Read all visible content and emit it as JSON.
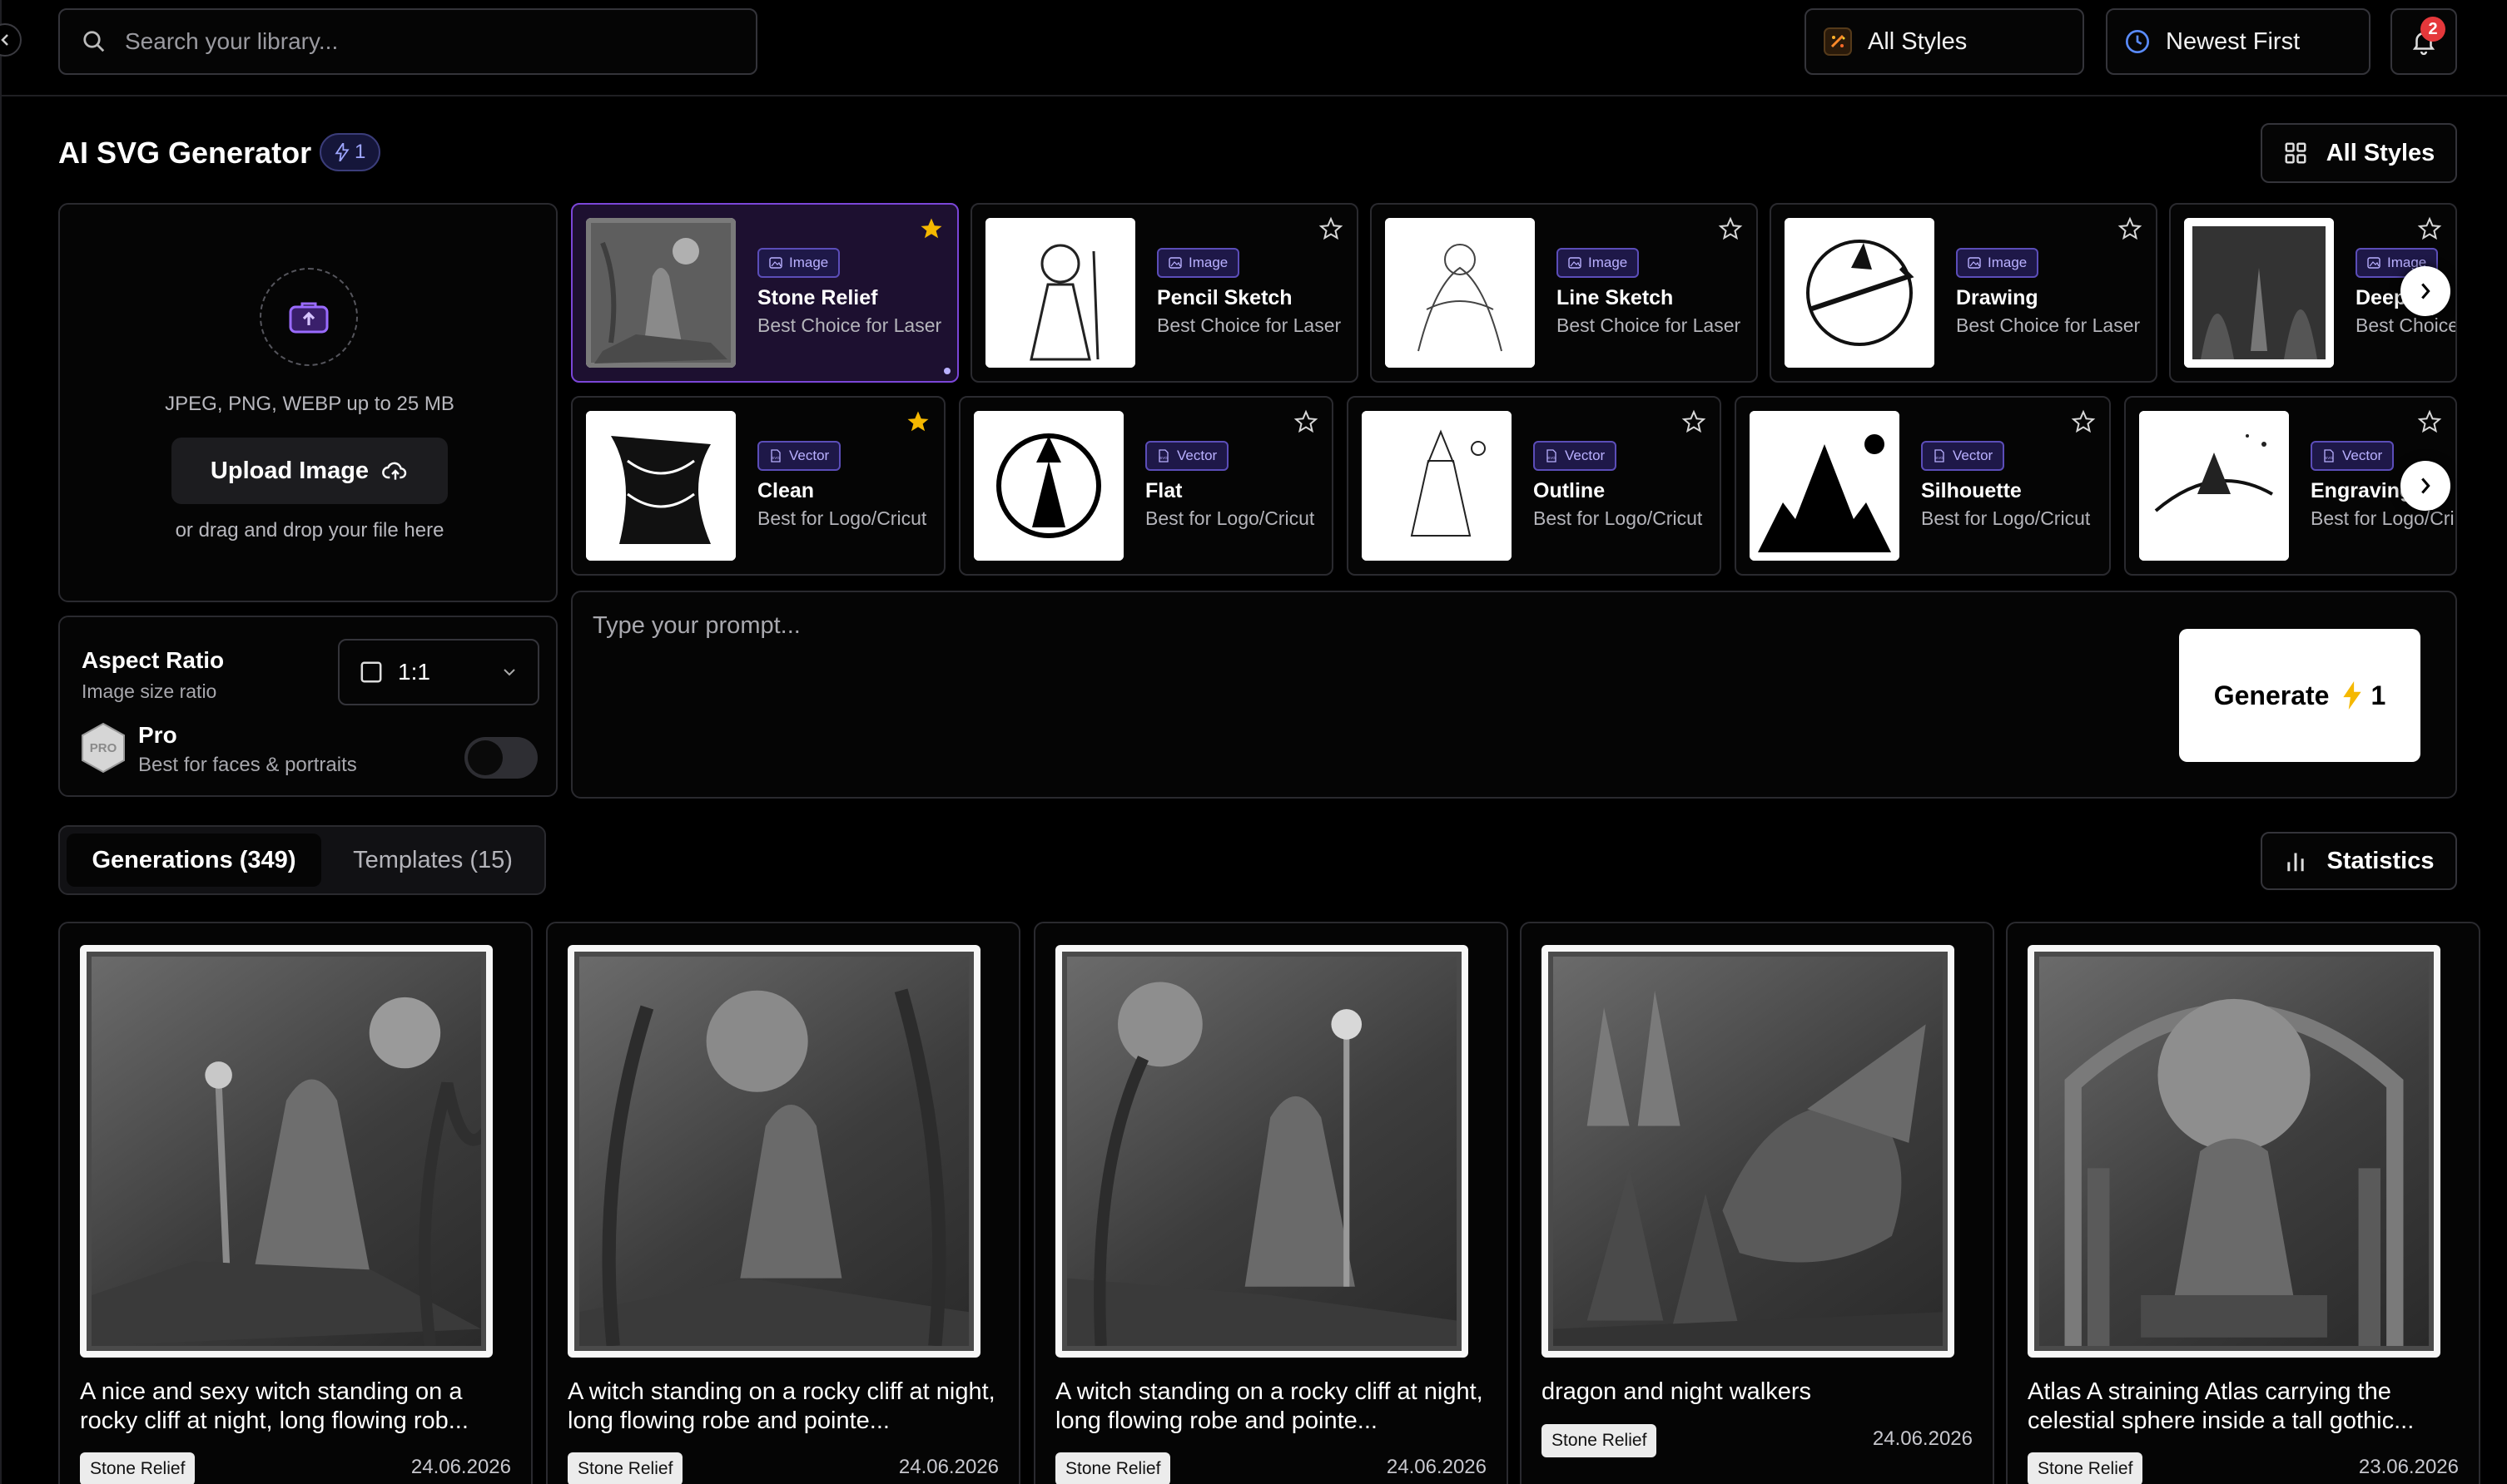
{
  "topbar": {
    "search_placeholder": "Search your library...",
    "style_filter": "All Styles",
    "sort": "Newest First",
    "notifications_count": "2"
  },
  "header": {
    "title": "AI SVG Generator",
    "credits": "1",
    "all_styles_button": "All Styles"
  },
  "upload": {
    "formats": "JPEG, PNG, WEBP up to 25 MB",
    "button": "Upload Image",
    "drag_hint": "or drag and drop your file here"
  },
  "aspect": {
    "title": "Aspect Ratio",
    "subtitle": "Image size ratio",
    "value": "1:1",
    "pro_badge": "PRO",
    "pro_label": "Pro",
    "pro_sub": "Best for faces & portraits"
  },
  "styles_row1": [
    {
      "tag": "Image",
      "name": "Stone Relief",
      "sub": "Best Choice for Laser",
      "favorite": true,
      "selected": true
    },
    {
      "tag": "Image",
      "name": "Pencil Sketch",
      "sub": "Best Choice for Laser",
      "favorite": false
    },
    {
      "tag": "Image",
      "name": "Line Sketch",
      "sub": "Best Choice for Laser",
      "favorite": false
    },
    {
      "tag": "Image",
      "name": "Drawing",
      "sub": "Best Choice for Laser",
      "favorite": false
    },
    {
      "tag": "Image",
      "name": "Deep Ra",
      "sub": "Best Choice",
      "favorite": false
    }
  ],
  "styles_row2": [
    {
      "tag": "Vector",
      "name": "Clean",
      "sub": "Best for Logo/Cricut",
      "favorite": true
    },
    {
      "tag": "Vector",
      "name": "Flat",
      "sub": "Best for Logo/Cricut",
      "favorite": false
    },
    {
      "tag": "Vector",
      "name": "Outline",
      "sub": "Best for Logo/Cricut",
      "favorite": false
    },
    {
      "tag": "Vector",
      "name": "Silhouette",
      "sub": "Best for Logo/Cricut",
      "favorite": false
    },
    {
      "tag": "Vector",
      "name": "Engraving",
      "sub": "Best for Logo/Cri",
      "favorite": false
    }
  ],
  "prompt": {
    "placeholder": "Type your prompt...",
    "generate_label": "Generate",
    "generate_cost": "1"
  },
  "tabs": {
    "generations": "Generations (349)",
    "templates": "Templates (15)",
    "statistics": "Statistics"
  },
  "gallery": [
    {
      "title": "A nice and sexy witch standing on a rocky cliff at night, long flowing rob...",
      "tag": "Stone Relief",
      "date": "24.06.2026"
    },
    {
      "title": "A witch standing on a rocky cliff at night, long flowing robe and pointe...",
      "tag": "Stone Relief",
      "date": "24.06.2026"
    },
    {
      "title": "A witch standing on a rocky cliff at night, long flowing robe and pointe...",
      "tag": "Stone Relief",
      "date": "24.06.2026"
    },
    {
      "title": "dragon and night walkers",
      "tag": "Stone Relief",
      "date": "24.06.2026"
    },
    {
      "title": "Atlas A straining Atlas carrying the celestial sphere inside a tall gothic...",
      "tag": "Stone Relief",
      "date": "23.06.2026"
    }
  ],
  "colors": {
    "accent_purple": "#7b46d8",
    "star_gold": "#f5b800",
    "notification_red": "#e5383b"
  }
}
